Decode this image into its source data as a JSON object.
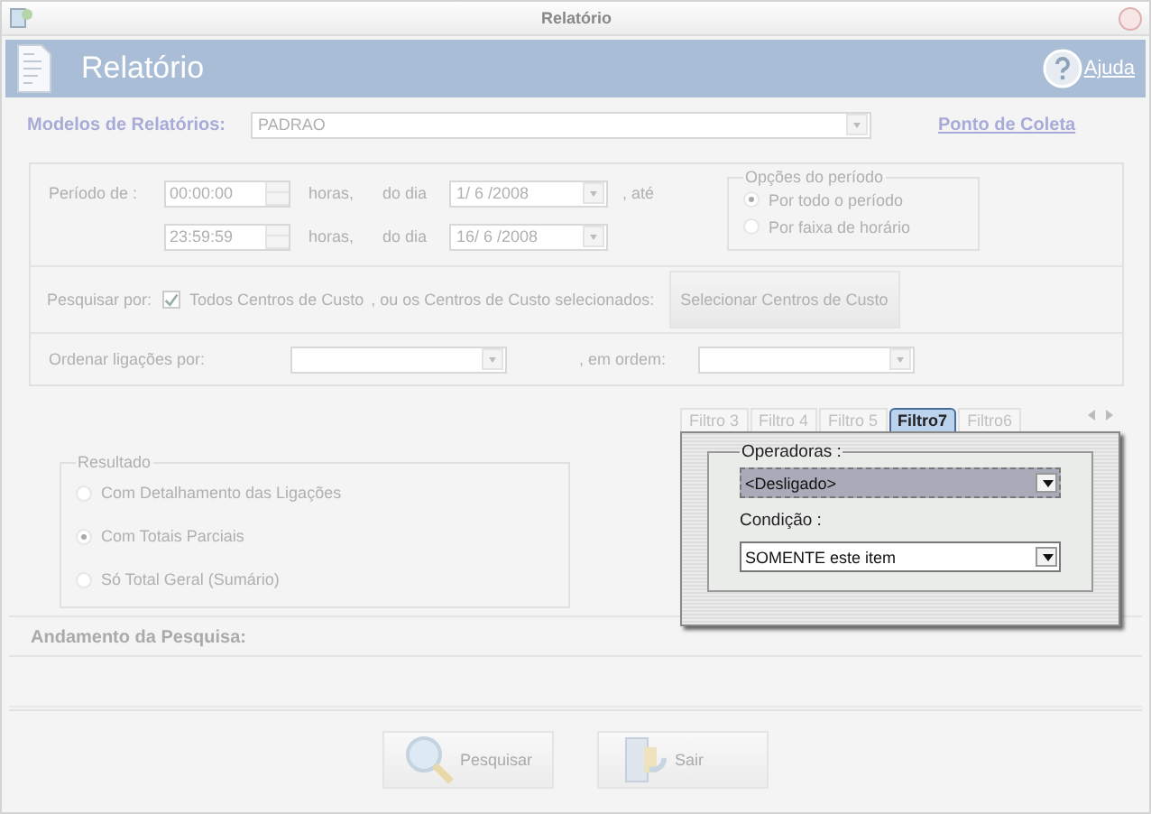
{
  "window": {
    "title": "Relatório"
  },
  "header": {
    "title": "Relatório",
    "help": "Ajuda"
  },
  "form": {
    "disabled": true
  },
  "models": {
    "label": "Modelos de Relatórios:",
    "value": "PADRAO",
    "link": "Ponto de Coleta"
  },
  "period": {
    "label": "Período de :",
    "rows": [
      {
        "time": "00:00:00",
        "hours": "horas,",
        "day_label": "do dia",
        "date": "1/ 6 /2008",
        "until": ", até"
      },
      {
        "time": "23:59:59",
        "hours": "horas,",
        "day_label": "do dia",
        "date": "16/ 6 /2008"
      }
    ],
    "options": {
      "title": "Opções do período",
      "items": [
        {
          "label": "Por todo o período",
          "selected": true
        },
        {
          "label": "Por faixa de horário",
          "selected": false
        }
      ]
    }
  },
  "search_by": {
    "label": "Pesquisar por:",
    "checkbox": {
      "label": "Todos Centros de Custo",
      "checked": true
    },
    "after": ", ou os Centros de Custo selecionados:",
    "button": "Selecionar Centros de Custo"
  },
  "order": {
    "label": "Ordenar ligações por:",
    "order_label": ", em ordem:"
  },
  "result": {
    "title": "Resultado",
    "items": [
      {
        "label": "Com Detalhamento das Ligações",
        "selected": false
      },
      {
        "label": "Com Totais  Parciais",
        "selected": true
      },
      {
        "label": "Só Total  Geral (Sumário)",
        "selected": false
      }
    ]
  },
  "filters": {
    "tabs": [
      {
        "label": "Filtro 3",
        "selected": false
      },
      {
        "label": "Filtro 4",
        "selected": false
      },
      {
        "label": "Filtro 5",
        "selected": false
      },
      {
        "label": "Filtro7",
        "selected": true
      },
      {
        "label": "Filtro6",
        "selected": false
      }
    ],
    "group": "Operadoras :",
    "operator": "<Desligado>",
    "condition_label": "Condição :",
    "condition": "SOMENTE este item"
  },
  "progress": {
    "label": "Andamento da Pesquisa:"
  },
  "buttons": [
    {
      "label": "Pesquisar",
      "kind": "search"
    },
    {
      "label": "Sair",
      "kind": "exit"
    }
  ]
}
